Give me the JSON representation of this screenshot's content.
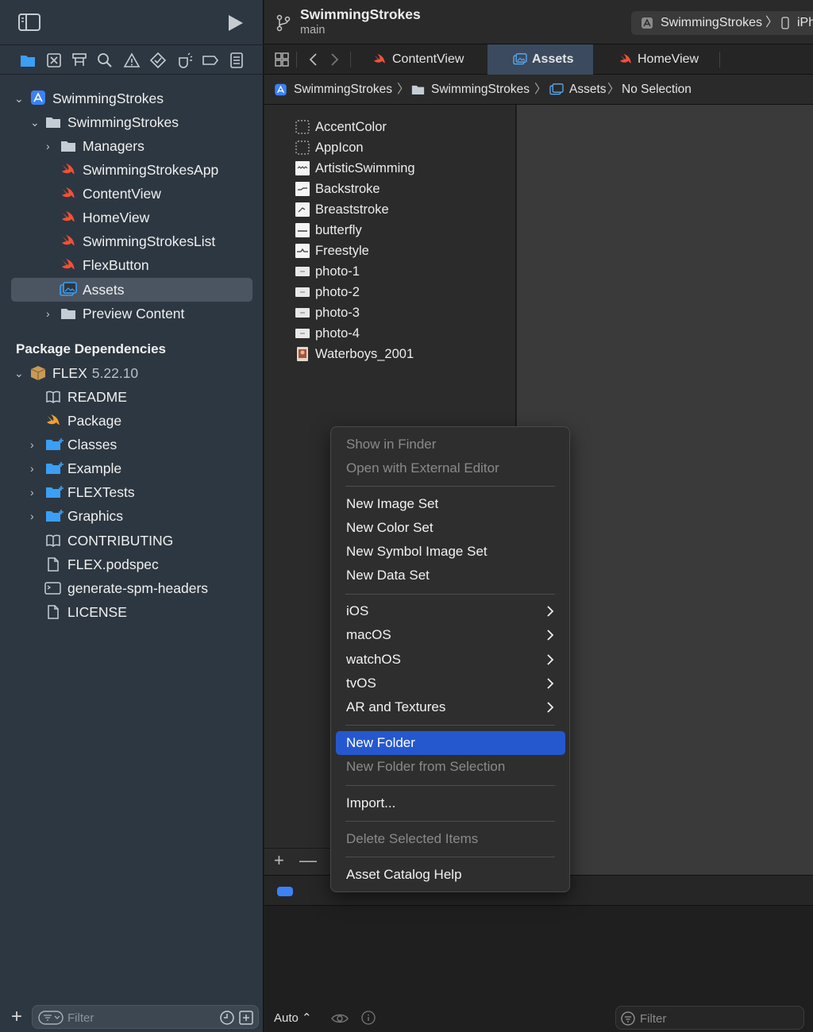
{
  "project_navigator": {
    "items": [
      {
        "label": "SwimmingStrokes",
        "type": "project"
      },
      {
        "label": "SwimmingStrokes",
        "type": "folder"
      },
      {
        "label": "Managers",
        "type": "folder"
      },
      {
        "label": "SwimmingStrokesApp",
        "type": "swift"
      },
      {
        "label": "ContentView",
        "type": "swift"
      },
      {
        "label": "HomeView",
        "type": "swift"
      },
      {
        "label": "SwimmingStrokesList",
        "type": "swift"
      },
      {
        "label": "FlexButton",
        "type": "swift"
      },
      {
        "label": "Assets",
        "type": "assets",
        "selected": true
      },
      {
        "label": "Preview Content",
        "type": "folder"
      }
    ],
    "package_header": "Package Dependencies",
    "package": {
      "name": "FLEX",
      "version": "5.22.10"
    },
    "package_items": [
      {
        "label": "README",
        "type": "book"
      },
      {
        "label": "Package",
        "type": "swift"
      },
      {
        "label": "Classes",
        "type": "folder-plus"
      },
      {
        "label": "Example",
        "type": "folder-plus"
      },
      {
        "label": "FLEXTests",
        "type": "folder-plus"
      },
      {
        "label": "Graphics",
        "type": "folder-plus"
      },
      {
        "label": "CONTRIBUTING",
        "type": "book"
      },
      {
        "label": "FLEX.podspec",
        "type": "doc"
      },
      {
        "label": "generate-spm-headers",
        "type": "terminal"
      },
      {
        "label": "LICENSE",
        "type": "doc"
      }
    ],
    "filter_placeholder": "Filter"
  },
  "toolbar": {
    "project_name": "SwimmingStrokes",
    "branch": "main",
    "scheme": "SwimmingStrokes",
    "scheme_separator": "〉",
    "destination": "iPh"
  },
  "tabs": [
    {
      "label": "ContentView",
      "active": false
    },
    {
      "label": "Assets",
      "active": true
    },
    {
      "label": "HomeView",
      "active": false
    }
  ],
  "jump_bar": {
    "items": [
      "SwimmingStrokes",
      "SwimmingStrokes",
      "Assets",
      "No Selection"
    ],
    "separator": "〉"
  },
  "asset_catalog": {
    "items": [
      {
        "label": "AccentColor",
        "icon": "color-set"
      },
      {
        "label": "AppIcon",
        "icon": "app-icon-set"
      },
      {
        "label": "ArtisticSwimming",
        "icon": "image-set"
      },
      {
        "label": "Backstroke",
        "icon": "image-set"
      },
      {
        "label": "Breaststroke",
        "icon": "image-set"
      },
      {
        "label": "butterfly",
        "icon": "image-set"
      },
      {
        "label": "Freestyle",
        "icon": "image-set"
      },
      {
        "label": "photo-1",
        "icon": "image-set"
      },
      {
        "label": "photo-2",
        "icon": "image-set"
      },
      {
        "label": "photo-3",
        "icon": "image-set"
      },
      {
        "label": "photo-4",
        "icon": "image-set"
      },
      {
        "label": "Waterboys_2001",
        "icon": "photo-set"
      }
    ]
  },
  "debug_bar": {
    "auto_label": "Auto ⌃",
    "filter_placeholder": "Filter"
  },
  "context_menu": {
    "groups": [
      [
        {
          "label": "Show in Finder",
          "enabled": false
        },
        {
          "label": "Open with External Editor",
          "enabled": false
        }
      ],
      [
        {
          "label": "New Image Set",
          "enabled": true
        },
        {
          "label": "New Color Set",
          "enabled": true
        },
        {
          "label": "New Symbol Image Set",
          "enabled": true
        },
        {
          "label": "New Data Set",
          "enabled": true
        }
      ],
      [
        {
          "label": "iOS",
          "enabled": true,
          "submenu": true
        },
        {
          "label": "macOS",
          "enabled": true,
          "submenu": true
        },
        {
          "label": "watchOS",
          "enabled": true,
          "submenu": true
        },
        {
          "label": "tvOS",
          "enabled": true,
          "submenu": true
        },
        {
          "label": "AR and Textures",
          "enabled": true,
          "submenu": true
        }
      ],
      [
        {
          "label": "New Folder",
          "enabled": true,
          "highlighted": true
        },
        {
          "label": "New Folder from Selection",
          "enabled": false
        }
      ],
      [
        {
          "label": "Import...",
          "enabled": true
        }
      ],
      [
        {
          "label": "Delete Selected Items",
          "enabled": false
        }
      ],
      [
        {
          "label": "Asset Catalog Help",
          "enabled": true
        }
      ]
    ]
  },
  "colors": {
    "accent": "#2558cf",
    "swift": "#f05138",
    "sidebar_bg": "#2d3741",
    "folder": "#c4cdd6",
    "folder_blue": "#3b9ff5"
  }
}
